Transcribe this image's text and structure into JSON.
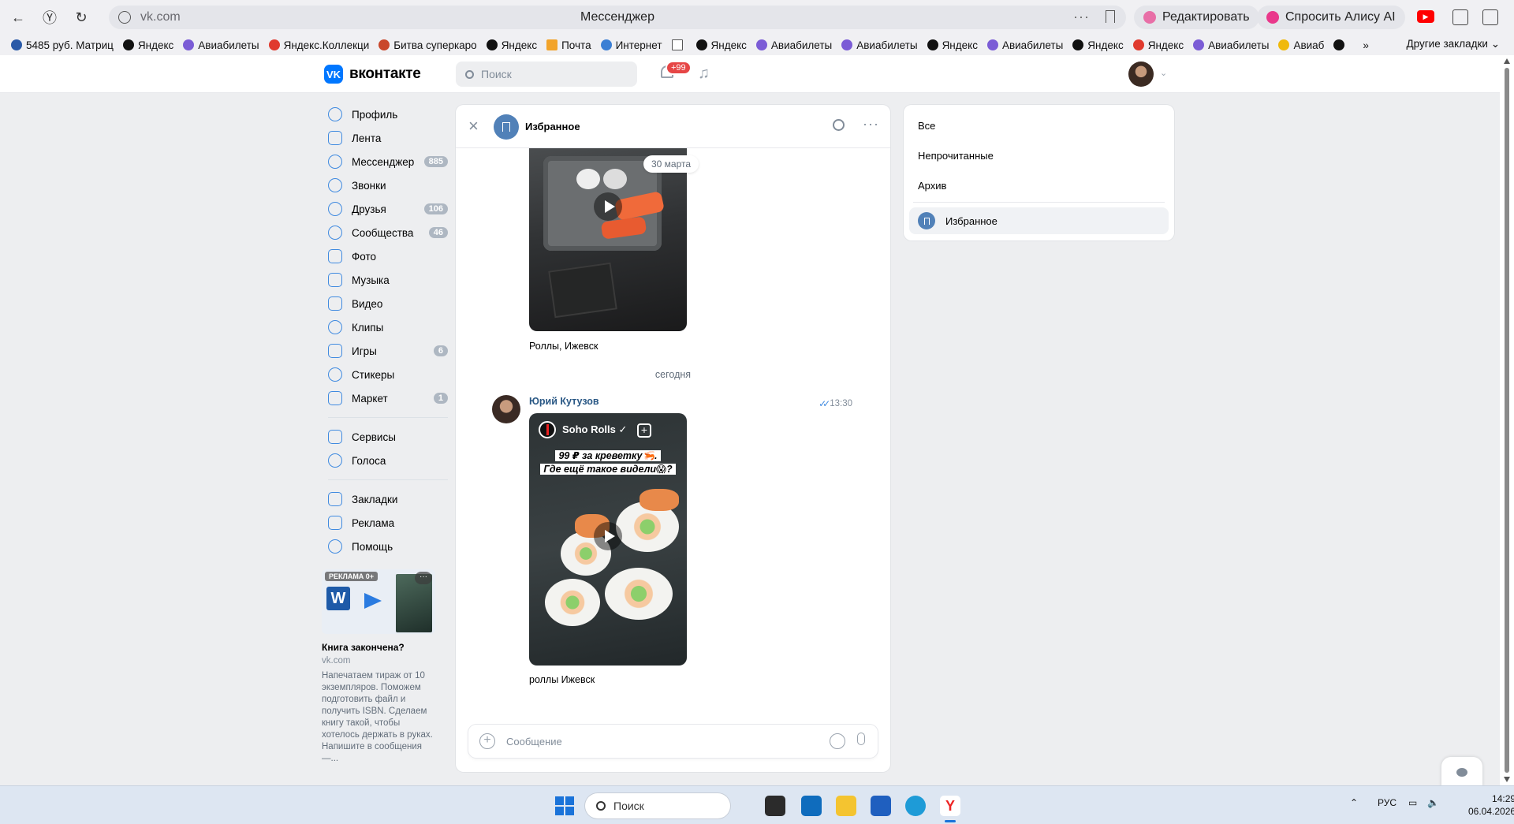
{
  "browser": {
    "url": "vk.com",
    "page_title": "Мессенджер",
    "edit_label": "Редактировать",
    "alice_label": "Спросить Алису AI"
  },
  "bookmarks": {
    "items": [
      "5485 руб. Матриц",
      "Яндекс",
      "Авиабилеты",
      "Яндекс.Коллекци",
      "Битва суперкаро",
      "Яндекс",
      "Почта",
      "Интернет",
      "Яндекс",
      "Авиабилеты",
      "Авиабилеты",
      "Яндекс",
      "Авиабилеты",
      "Яндекс",
      "Яндекс",
      "Авиабилеты",
      "Авиаб"
    ],
    "more": "»",
    "other": "Другие закладки"
  },
  "vk_header": {
    "logo_text": "вконтакте",
    "search_placeholder": "Поиск",
    "notif_badge": "+99"
  },
  "sidebar": {
    "items": [
      {
        "label": "Профиль",
        "count": ""
      },
      {
        "label": "Лента",
        "count": ""
      },
      {
        "label": "Мессенджер",
        "count": "885"
      },
      {
        "label": "Звонки",
        "count": ""
      },
      {
        "label": "Друзья",
        "count": "106"
      },
      {
        "label": "Сообщества",
        "count": "46"
      },
      {
        "label": "Фото",
        "count": ""
      },
      {
        "label": "Музыка",
        "count": ""
      },
      {
        "label": "Видео",
        "count": ""
      },
      {
        "label": "Клипы",
        "count": ""
      },
      {
        "label": "Игры",
        "count": "6"
      },
      {
        "label": "Стикеры",
        "count": ""
      },
      {
        "label": "Маркет",
        "count": "1"
      }
    ],
    "items2": [
      {
        "label": "Сервисы"
      },
      {
        "label": "Голоса"
      }
    ],
    "items3": [
      {
        "label": "Закладки"
      },
      {
        "label": "Реклама"
      },
      {
        "label": "Помощь"
      }
    ]
  },
  "ad": {
    "badge": "РЕКЛАМА 0+",
    "title": "Книга закончена?",
    "domain": "vk.com",
    "text": "Напечатаем тираж от 10 экземпляров. Поможем подготовить файл и получить ISBN. Сделаем книгу такой, чтобы хотелось держать в руках. Напишите в сообщения —..."
  },
  "chat": {
    "title": "Избранное",
    "date_pill": "30 марта",
    "caption1": "Роллы, Ижевск",
    "day_separator": "сегодня",
    "author": "Юрий Кутузов",
    "time": "13:30",
    "video2_channel": "Soho Rolls ✓",
    "video2_caption_line1": "99 ₽ за креветку🦐.",
    "video2_caption_line2": "Где ещё такое видели😱?",
    "caption2": "роллы Ижевск",
    "composer_placeholder": "Сообщение"
  },
  "folders": {
    "all": "Все",
    "unread": "Непрочитанные",
    "archive": "Архив",
    "favorites": "Избранное"
  },
  "taskbar": {
    "search_placeholder": "Поиск",
    "lang": "РУС",
    "time": "14:29",
    "date": "06.04.2026"
  },
  "colors": {
    "vk_blue": "#0077ff",
    "link_blue": "#2a5885",
    "badge_red": "#e64646",
    "page_bg": "#edeef0"
  }
}
